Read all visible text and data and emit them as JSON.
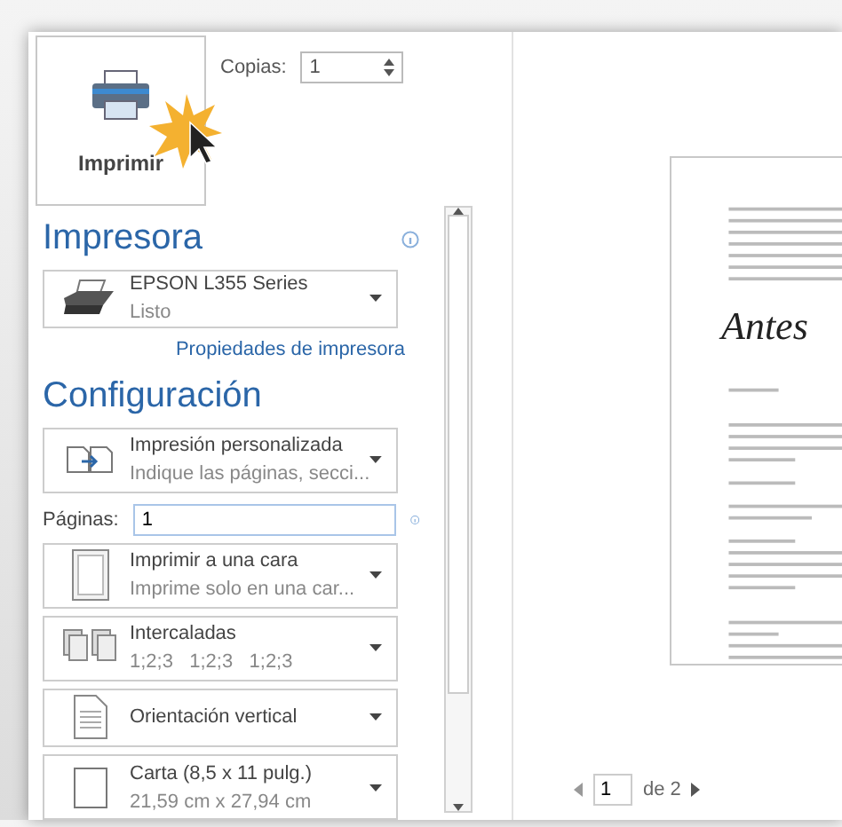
{
  "print_button": {
    "label": "Imprimir"
  },
  "copies": {
    "label": "Copias:",
    "value": "1"
  },
  "printer_section": {
    "title": "Impresora",
    "printer": {
      "name": "EPSON L355 Series",
      "status": "Listo"
    },
    "properties_link": "Propiedades de impresora"
  },
  "settings_section": {
    "title": "Configuración",
    "items": [
      {
        "kind": "custom",
        "title": "Impresión personalizada",
        "subtitle": "Indique las páginas, secci..."
      },
      {
        "kind": "pages",
        "label": "Páginas:",
        "value": "1"
      },
      {
        "kind": "one_sided",
        "title": "Imprimir a una cara",
        "subtitle": "Imprime solo en una car..."
      },
      {
        "kind": "collated",
        "title": "Intercaladas",
        "subtitle": "1;2;3   1;2;3   1;2;3"
      },
      {
        "kind": "orientation",
        "title": "Orientación vertical"
      },
      {
        "kind": "paper",
        "title": "Carta (8,5 x 11 pulg.)",
        "subtitle": "21,59 cm x 27,94 cm"
      }
    ]
  },
  "preview": {
    "handwriting": "Antes",
    "page_number": "1",
    "page_total": "de 2"
  }
}
